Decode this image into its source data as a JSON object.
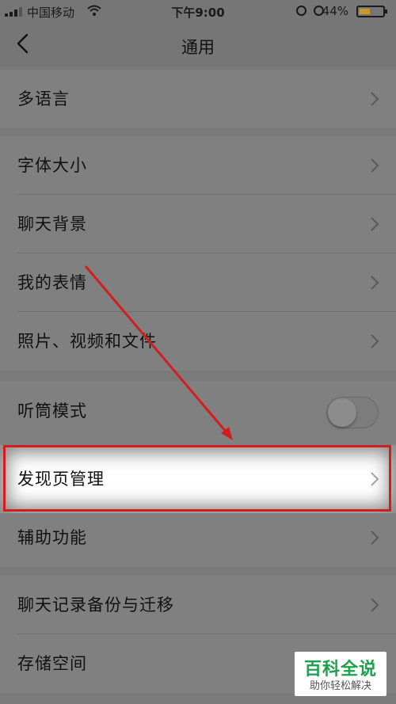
{
  "status_bar": {
    "carrier": "中国移动",
    "time": "下午9:00",
    "battery": "44%",
    "battery_level": 0.44
  },
  "nav": {
    "title": "通用"
  },
  "settings": {
    "language": "多语言",
    "font_size": "字体大小",
    "chat_background": "聊天背景",
    "my_stickers": "我的表情",
    "photos_videos_files": "照片、视频和文件",
    "earpiece_mode": "听筒模式",
    "earpiece_mode_on": false,
    "discover_management": "发现页管理",
    "accessibility": "辅助功能",
    "chat_backup_migrate": "聊天记录备份与迁移",
    "storage": "存储空间"
  },
  "watermark": {
    "main": "百科全说",
    "sub": "助你轻松解决"
  },
  "colors": {
    "annotation_red": "#d11f1f",
    "watermark_green": "#1aa34a"
  }
}
